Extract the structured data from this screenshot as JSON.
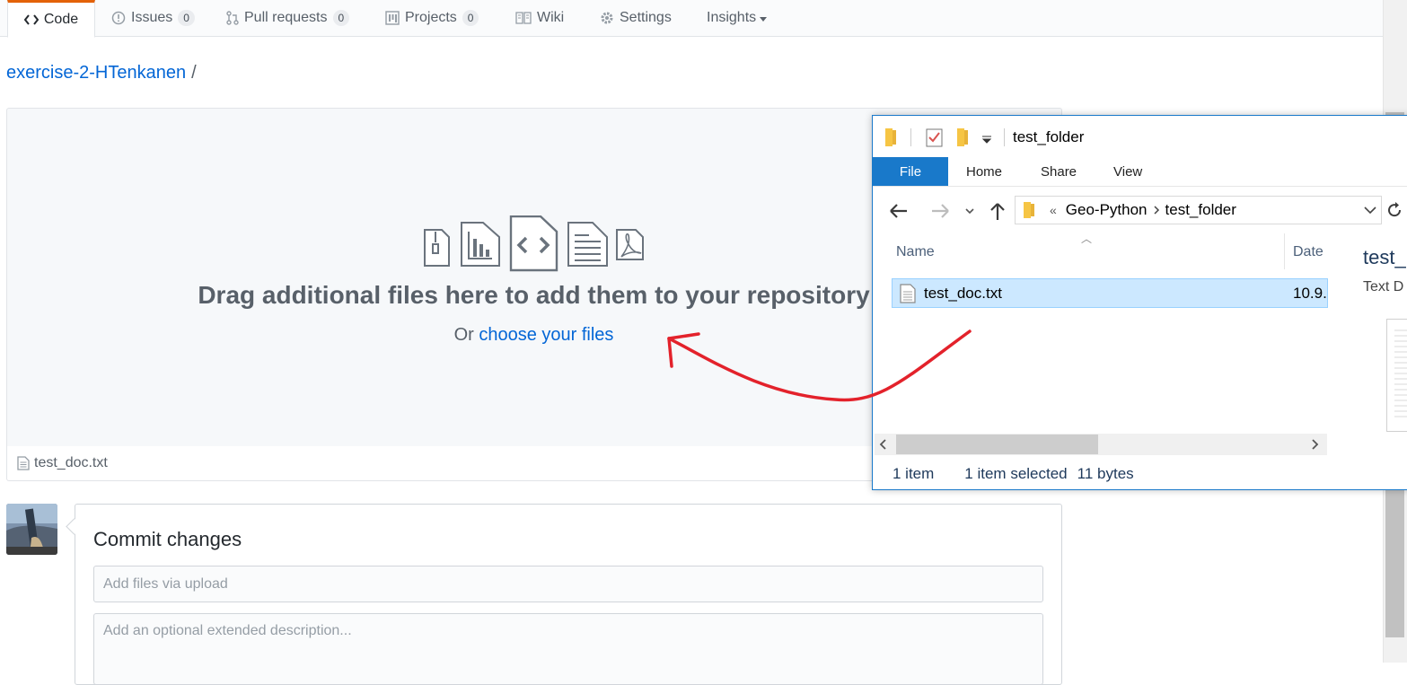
{
  "repo_nav": {
    "tabs": [
      {
        "label": "Code",
        "icon": "code-icon"
      },
      {
        "label": "Issues",
        "count": "0",
        "icon": "issue-icon"
      },
      {
        "label": "Pull requests",
        "count": "0",
        "icon": "pull-request-icon"
      },
      {
        "label": "Projects",
        "count": "0",
        "icon": "project-icon"
      },
      {
        "label": "Wiki",
        "icon": "book-icon"
      },
      {
        "label": "Settings",
        "icon": "gear-icon"
      },
      {
        "label": "Insights",
        "icon": "chevron-down-icon"
      }
    ]
  },
  "breadcrumb": {
    "repo": "exercise-2-HTenkanen",
    "separator": "/"
  },
  "dropzone": {
    "title": "Drag additional files here to add them to your repository",
    "sub_prefix": "Or",
    "sub_link": "choose your files"
  },
  "uploaded_files": [
    "test_doc.txt"
  ],
  "commit": {
    "title": "Commit changes",
    "summary_placeholder": "Add files via upload",
    "description_placeholder": "Add an optional extended description..."
  },
  "explorer": {
    "title": "test_folder",
    "ribbon_tabs": [
      "File",
      "Home",
      "Share",
      "View"
    ],
    "address": {
      "overflow": "«",
      "segments": [
        "Geo-Python",
        "test_folder"
      ]
    },
    "columns": {
      "name": "Name",
      "date": "Date"
    },
    "file": {
      "name": "test_doc.txt",
      "date": "10.9."
    },
    "preview": {
      "title": "test_",
      "type": "Text D"
    },
    "status": {
      "items": "1 item",
      "selected": "1 item selected",
      "size": "11 bytes"
    }
  },
  "colors": {
    "link": "#0366d6",
    "accent_tab": "#e36209",
    "explorer_blue": "#1979ca",
    "arrow": "#e3222b"
  }
}
